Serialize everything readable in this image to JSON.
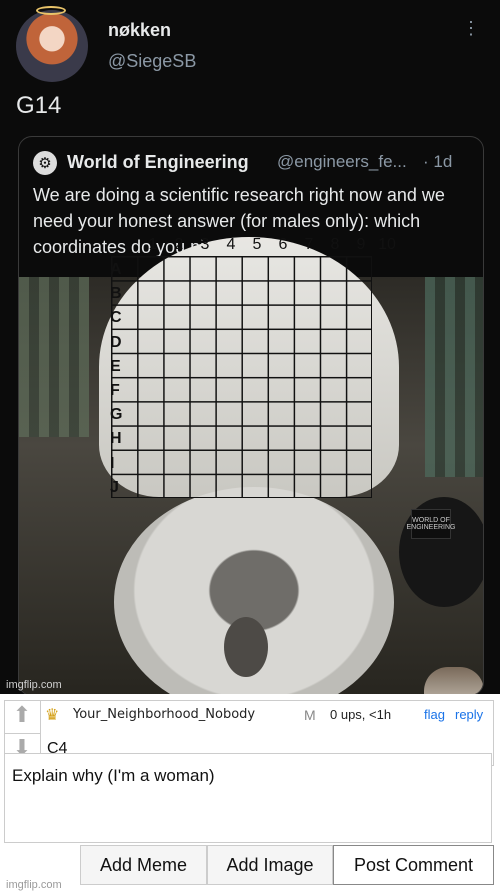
{
  "tweet": {
    "display_name": "nøkken",
    "handle": "@SiegeSB",
    "text": "G14",
    "more_icon": "⋮"
  },
  "quote": {
    "account_name": "World of Engineering",
    "handle": "@engineers_fe...",
    "time": "· 1d",
    "body": "We are doing a scientific research right now and we need your honest answer (for males only): which coordinates do you piss in?",
    "photo": {
      "columns": [
        "1",
        "2",
        "3",
        "4",
        "5",
        "6",
        "7",
        "8",
        "9",
        "10"
      ],
      "rows": [
        "A",
        "B",
        "C",
        "D",
        "E",
        "F",
        "G",
        "H",
        "I",
        "J"
      ],
      "bin_label": "WORLD OF ENGINEERING"
    }
  },
  "meme_watermark": "imgflip.com",
  "comment": {
    "username": "Your_Neighborhood_Nobody",
    "badge": "M",
    "meta": "0 ups, <1h",
    "flag_label": "flag",
    "reply_label": "reply",
    "text": "C4"
  },
  "reply_input": {
    "value": "Explain why (I'm a woman)"
  },
  "buttons": {
    "add_meme": "Add Meme",
    "add_image": "Add Image",
    "post_comment": "Post Comment"
  },
  "footer_watermark": "imgflip.com"
}
